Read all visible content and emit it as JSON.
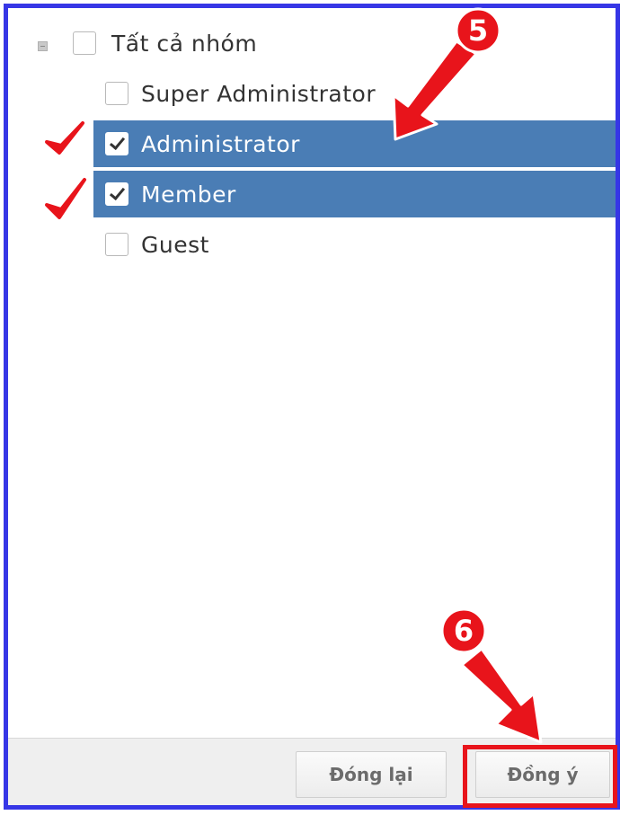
{
  "group_tree": {
    "root": {
      "label": "Tất cả nhóm",
      "checked": false
    },
    "items": [
      {
        "label": "Super Administrator",
        "checked": false
      },
      {
        "label": "Administrator",
        "checked": true
      },
      {
        "label": "Member",
        "checked": true
      },
      {
        "label": "Guest",
        "checked": false
      }
    ]
  },
  "footer": {
    "close_label": "Đóng lại",
    "agree_label": "Đồng ý"
  },
  "annotations": {
    "step_select": "5",
    "step_confirm": "6",
    "color": "#e8141b"
  },
  "colors": {
    "frame_border": "#3636e6",
    "selected_row": "#4a7db5"
  },
  "icons": [
    "collapse-icon",
    "checkbox-icon",
    "check-mark-icon",
    "arrow-icon"
  ]
}
